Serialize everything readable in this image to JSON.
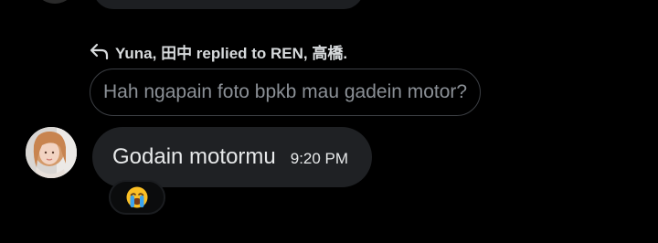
{
  "reply": {
    "context": "Yuna, 田中 replied to REN, 高橋.",
    "quoted_text": "Hah ngapain foto bpkb mau gadein motor?"
  },
  "message": {
    "text": "Godain motormu",
    "time": "9:20 PM"
  },
  "reaction": {
    "emoji": "loudly-crying-face"
  },
  "colors": {
    "background": "#000000",
    "bubble": "#1f2124",
    "quoted_border": "#3c3f44",
    "quoted_text": "#8b9096",
    "primary_text": "#e7e9ea"
  }
}
